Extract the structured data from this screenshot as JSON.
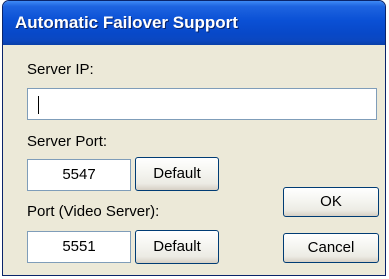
{
  "window": {
    "title": "Automatic Failover Support"
  },
  "server_ip": {
    "label": "Server IP:",
    "value": ""
  },
  "server_port": {
    "label": "Server Port:",
    "value": "5547",
    "default_label": "Default"
  },
  "video_port": {
    "label": "Port (Video Server):",
    "value": "5551",
    "default_label": "Default"
  },
  "buttons": {
    "ok": "OK",
    "cancel": "Cancel"
  },
  "colors": {
    "titlebar": "#0A50D5",
    "dialog_bg": "#ECE9D8",
    "input_border": "#7F9DB9",
    "button_border": "#003C74"
  }
}
